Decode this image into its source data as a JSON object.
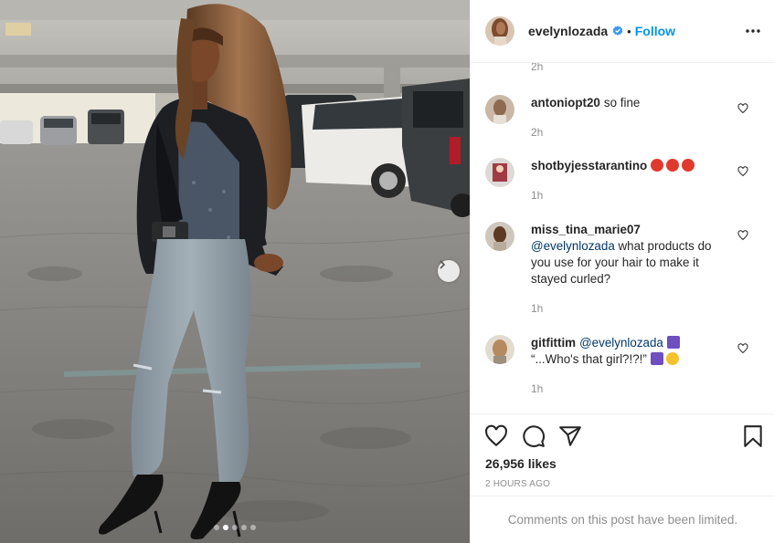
{
  "post": {
    "username": "evelynlozada",
    "separator": "•",
    "follow_label": "Follow",
    "photo_page": {
      "current": 2,
      "total": 5
    }
  },
  "comments": {
    "first_time": "2h",
    "items": [
      {
        "username": "antoniopt20",
        "text": "so fine",
        "time": "2h",
        "emojis": []
      },
      {
        "username": "shotbyjesstarantino",
        "text": "",
        "time": "1h",
        "emojis": [
          "angry-face",
          "angry-face",
          "angry-face"
        ]
      },
      {
        "username": "miss_tina_marie07",
        "mention": "@evelynlozada",
        "text": " what products do you use for your hair to make it stayed curled?",
        "time": "1h"
      },
      {
        "username": "gitfittim",
        "mention": "@evelynlozada",
        "line2": "“...Who's that girl?!?!”",
        "time": "1h"
      }
    ]
  },
  "actions": {
    "likes": "26,956 likes",
    "posted": "2 HOURS AGO"
  },
  "footer": {
    "limited_text": "Comments on this post have been limited."
  },
  "colors": {
    "accent": "#0095f6",
    "text": "#262626",
    "muted": "#8e8e8e",
    "mention": "#00376b"
  },
  "icons": [
    "verified-badge-icon",
    "more-options-icon",
    "chevron-right-icon",
    "heart-icon",
    "comment-icon",
    "share-icon",
    "bookmark-icon"
  ]
}
